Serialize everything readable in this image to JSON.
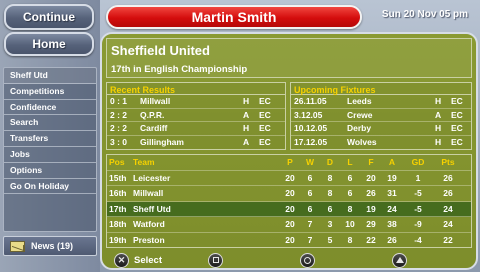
{
  "nav": {
    "continue_label": "Continue",
    "home_label": "Home",
    "menu": [
      {
        "label": "Sheff Utd"
      },
      {
        "label": "Competitions"
      },
      {
        "label": "Confidence"
      },
      {
        "label": "Search"
      },
      {
        "label": "Transfers"
      },
      {
        "label": "Jobs"
      },
      {
        "label": "Options"
      },
      {
        "label": "Go On Holiday"
      }
    ],
    "news_label": "News (19)"
  },
  "header": {
    "manager_name": "Martin Smith",
    "datetime": "Sun 20 Nov 05 pm"
  },
  "club": {
    "name": "Sheffield United",
    "position_text": "17th in English Championship"
  },
  "recent_results": {
    "title": "Recent Results",
    "rows": [
      {
        "score": "0 : 1",
        "opponent": "Millwall",
        "venue": "H",
        "comp": "EC"
      },
      {
        "score": "2 : 2",
        "opponent": "Q.P.R.",
        "venue": "A",
        "comp": "EC"
      },
      {
        "score": "2 : 2",
        "opponent": "Cardiff",
        "venue": "H",
        "comp": "EC"
      },
      {
        "score": "3 : 0",
        "opponent": "Gillingham",
        "venue": "A",
        "comp": "EC"
      }
    ]
  },
  "upcoming_fixtures": {
    "title": "Upcoming Fixtures",
    "rows": [
      {
        "date": "26.11.05",
        "opponent": "Leeds",
        "venue": "H",
        "comp": "EC"
      },
      {
        "date": "3.12.05",
        "opponent": "Crewe",
        "venue": "A",
        "comp": "EC"
      },
      {
        "date": "10.12.05",
        "opponent": "Derby",
        "venue": "H",
        "comp": "EC"
      },
      {
        "date": "17.12.05",
        "opponent": "Wolves",
        "venue": "H",
        "comp": "EC"
      }
    ]
  },
  "league_table": {
    "headers": {
      "pos": "Pos",
      "team": "Team",
      "p": "P",
      "w": "W",
      "d": "D",
      "l": "L",
      "f": "F",
      "a": "A",
      "gd": "GD",
      "pts": "Pts"
    },
    "rows": [
      {
        "pos": "15th",
        "team": "Leicester",
        "p": "20",
        "w": "6",
        "d": "8",
        "l": "6",
        "f": "20",
        "a": "19",
        "gd": "1",
        "pts": "26"
      },
      {
        "pos": "16th",
        "team": "Millwall",
        "p": "20",
        "w": "6",
        "d": "8",
        "l": "6",
        "f": "26",
        "a": "31",
        "gd": "-5",
        "pts": "26"
      },
      {
        "pos": "17th",
        "team": "Sheff Utd",
        "p": "20",
        "w": "6",
        "d": "6",
        "l": "8",
        "f": "19",
        "a": "24",
        "gd": "-5",
        "pts": "24",
        "highlight": true
      },
      {
        "pos": "18th",
        "team": "Watford",
        "p": "20",
        "w": "7",
        "d": "3",
        "l": "10",
        "f": "29",
        "a": "38",
        "gd": "-9",
        "pts": "24"
      },
      {
        "pos": "19th",
        "team": "Preston",
        "p": "20",
        "w": "7",
        "d": "5",
        "l": "8",
        "f": "22",
        "a": "26",
        "gd": "-4",
        "pts": "22"
      }
    ]
  },
  "controls": {
    "cross_label": "Select"
  },
  "colors": {
    "panel": "#83932f",
    "highlight_row": "#466c1e",
    "accent_yellow": "#f6d100",
    "name_bar_red": "#d40d0d"
  }
}
